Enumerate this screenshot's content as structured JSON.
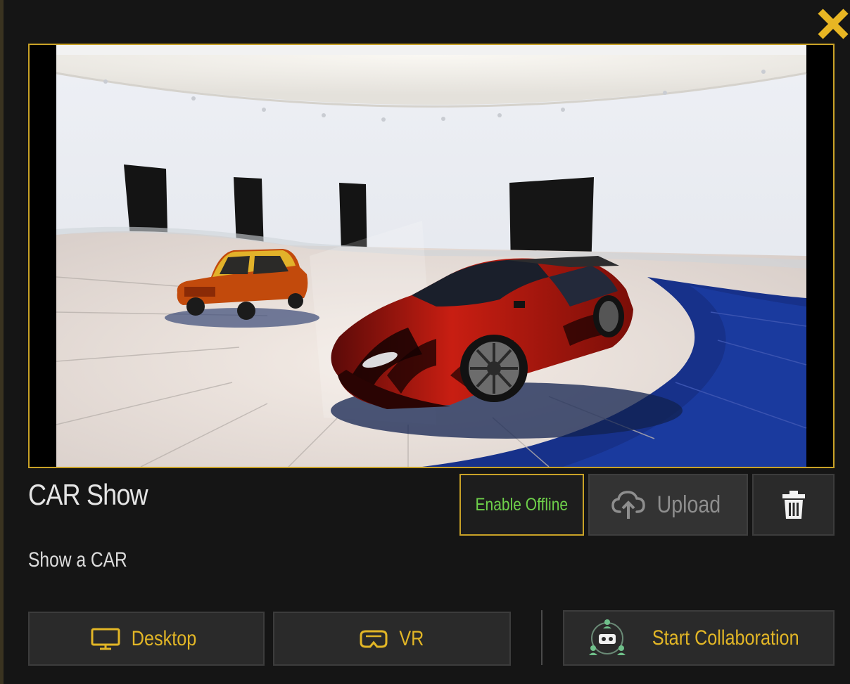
{
  "dialog": {
    "close_label": "close",
    "project": {
      "title": "CAR Show",
      "description": "Show a CAR"
    },
    "actions": {
      "enable_offline": "Enable Offline",
      "upload": "Upload",
      "delete": "delete"
    },
    "launch": {
      "desktop": "Desktop",
      "vr": "VR",
      "collaboration": "Start Collaboration"
    }
  },
  "icons": {
    "close": "close-icon",
    "upload": "cloud-upload-icon",
    "delete": "trash-icon",
    "desktop": "monitor-icon",
    "vr": "vr-headset-icon",
    "collaboration": "collaboration-icon"
  },
  "colors": {
    "accent": "#c9a227",
    "button_gold_text": "#e2b626",
    "offline_text": "#6ed04a",
    "background": "#151515",
    "button_bg": "#2a2a2a"
  }
}
